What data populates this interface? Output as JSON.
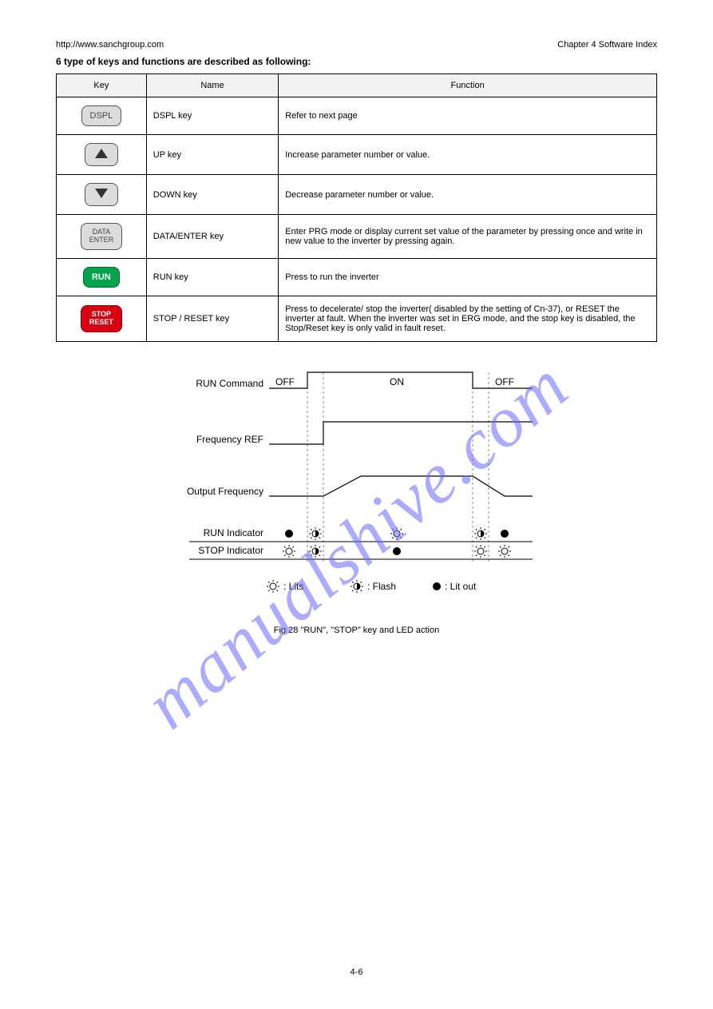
{
  "header": {
    "left": "http://www.sanchgroup.com",
    "right": "Chapter 4 Software Index"
  },
  "section_title": "6 type of keys and functions are described as following:",
  "table": {
    "header": [
      "Key",
      "Name",
      "Function"
    ],
    "rows": [
      {
        "icon": "dspl",
        "icon_label": "DSPL",
        "name": "DSPL key",
        "func": "Refer to next page"
      },
      {
        "icon": "up",
        "icon_label": "",
        "name": "UP key",
        "func": "Increase parameter number or value."
      },
      {
        "icon": "down",
        "icon_label": "",
        "name": "DOWN key",
        "func": "Decrease parameter number or value."
      },
      {
        "icon": "data",
        "icon_label": "DATA\nENTER",
        "name": "DATA/ENTER key",
        "func": "Enter PRG mode or display current set value of the parameter by pressing once and write in new value to the inverter by pressing again."
      },
      {
        "icon": "run",
        "icon_label": "RUN",
        "name": "RUN key",
        "func": "Press to run the inverter"
      },
      {
        "icon": "stop",
        "icon_label": "STOP\nRESET",
        "name": "STOP / RESET key",
        "func": "Press to decelerate/ stop the inverter( disabled by the setting of Cn-37), or RESET the inverter at fault. When the inverter was set in ERG mode, and the stop key is disabled, the Stop/Reset key is only valid in fault reset."
      }
    ]
  },
  "diagram": {
    "labels": {
      "run_command": "RUN Command",
      "frequency_ref": "Frequency REF",
      "output_frequency": "Output Frequency",
      "run_indicator": "RUN  Indicator",
      "stop_indicator": "STOP Indicator",
      "off_left": "OFF",
      "on": "ON",
      "off_right": "OFF"
    },
    "legend": {
      "lits": "Lits",
      "flash": "Flash",
      "litout": "Lit out"
    }
  },
  "figure_caption": "Fig 28 \"RUN\", \"STOP\" key and LED action",
  "page_number": "4-6",
  "watermark": "manualshive.com"
}
